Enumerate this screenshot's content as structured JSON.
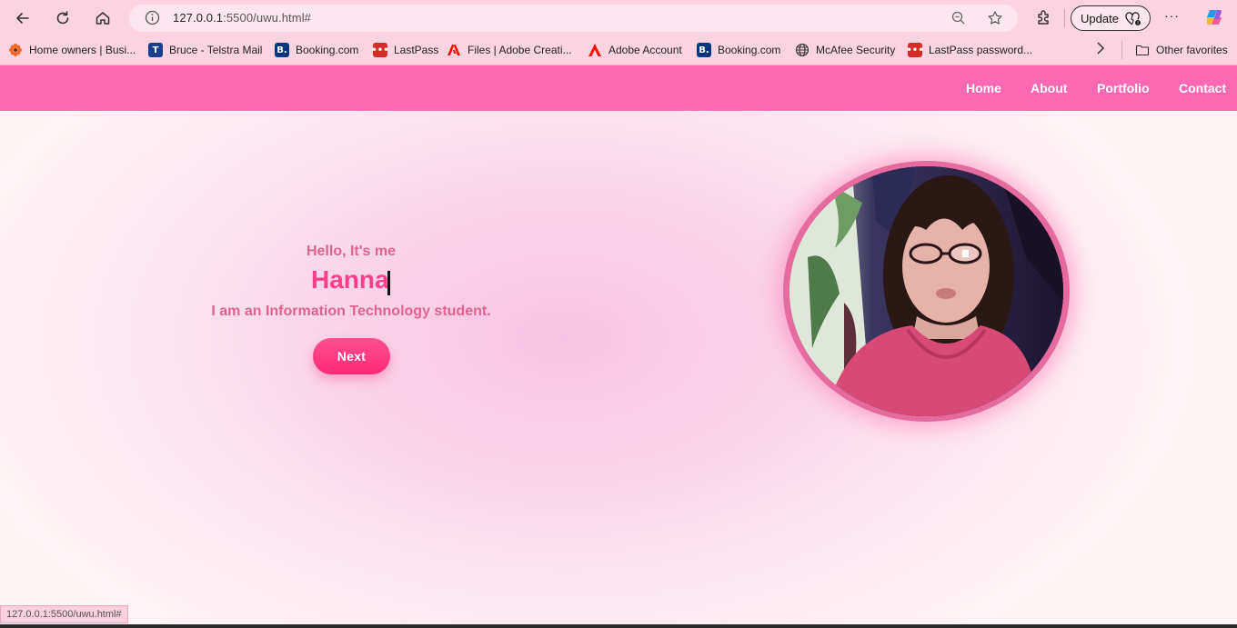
{
  "browser": {
    "url_host": "127.0.0.1",
    "url_path": ":5500/uwu.html#",
    "update_label": "Update",
    "more_label": "···",
    "bookmarks": [
      {
        "label": "Home owners | Busi...",
        "icon": "flower-icon",
        "color": "#f26522"
      },
      {
        "label": "Bruce - Telstra Mail",
        "icon": "telstra-icon",
        "color": "#1a3e8c"
      },
      {
        "label": "Booking.com",
        "icon": "booking-icon",
        "color": "#003580"
      },
      {
        "label": "LastPass",
        "icon": "lastpass-icon",
        "color": "#d32d27"
      },
      {
        "label": "Files | Adobe Creati...",
        "icon": "adobe-icon",
        "color": "#fa0f00"
      },
      {
        "label": "Adobe Account",
        "icon": "adobe-icon",
        "color": "#fa0f00"
      },
      {
        "label": "Booking.com",
        "icon": "booking-icon",
        "color": "#003580"
      },
      {
        "label": "McAfee Security",
        "icon": "globe-icon",
        "color": "#444444"
      },
      {
        "label": "LastPass password...",
        "icon": "lastpass-icon",
        "color": "#d32d27"
      }
    ],
    "other_favorites": "Other favorites",
    "status_url": "127.0.0.1:5500/uwu.html#"
  },
  "nav": {
    "home": "Home",
    "about": "About",
    "portfolio": "Portfolio",
    "contact": "Contact"
  },
  "hero": {
    "greeting": "Hello, It's me",
    "name": "Hanna",
    "description": "I am an Information Technology student.",
    "button_label": "Next"
  },
  "colors": {
    "navbar": "#ff69b4",
    "accent": "#ff3f8e",
    "text_pink": "#e0648f"
  }
}
